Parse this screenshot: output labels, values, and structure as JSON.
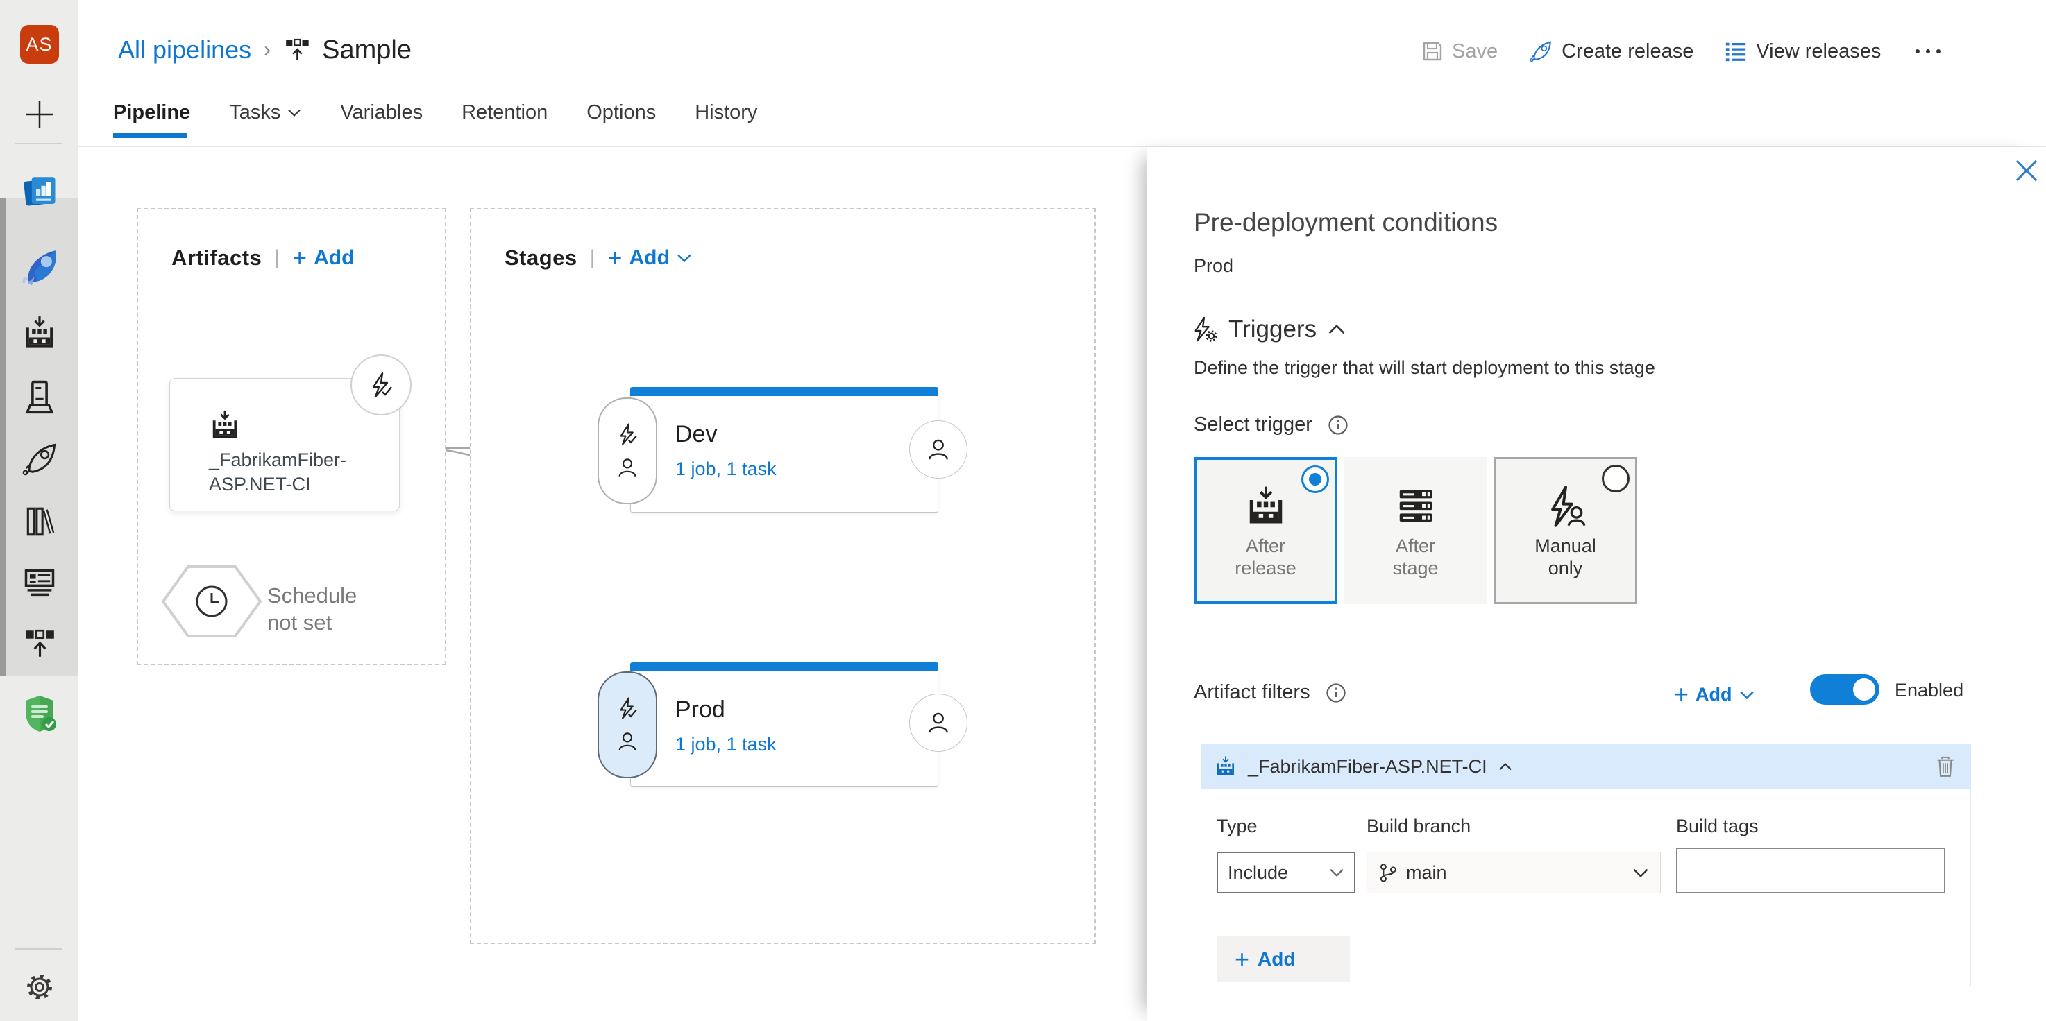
{
  "colors": {
    "accent": "#0e77d1",
    "stage_bar": "#0f7fd7",
    "sidebar_bg": "#ececeb",
    "hub_bg": "#dcdcda",
    "filter_header_bg": "#d9eafc",
    "selected_pill_bg": "#dcebf9",
    "avatar_bg": "#c93c0d"
  },
  "sidebar": {
    "avatar_text": "AS"
  },
  "header": {
    "breadcrumb": {
      "root": "All pipelines",
      "current": "Sample"
    },
    "actions": {
      "save": "Save",
      "create_release": "Create release",
      "view_releases": "View releases"
    }
  },
  "tabs": [
    {
      "label": "Pipeline",
      "active": true
    },
    {
      "label": "Tasks",
      "dropdown": true
    },
    {
      "label": "Variables"
    },
    {
      "label": "Retention"
    },
    {
      "label": "Options"
    },
    {
      "label": "History"
    }
  ],
  "canvas": {
    "artifacts": {
      "title": "Artifacts",
      "add_label": "Add",
      "artifact_name": "_FabrikamFiber-ASP.NET-CI",
      "schedule_text": "Schedule not set"
    },
    "stages": {
      "title": "Stages",
      "add_label": "Add",
      "items": [
        {
          "name": "Dev",
          "detail": "1 job, 1 task"
        },
        {
          "name": "Prod",
          "detail": "1 job, 1 task",
          "selected": true
        }
      ]
    }
  },
  "panel": {
    "title": "Pre-deployment conditions",
    "stage": "Prod",
    "triggers": {
      "heading": "Triggers",
      "description": "Define the trigger that will start deployment to this stage"
    },
    "select_trigger_label": "Select trigger",
    "trigger_options": [
      {
        "label": "After release",
        "selected": true
      },
      {
        "label": "After stage"
      },
      {
        "label": "Manual only"
      }
    ],
    "filters": {
      "heading": "Artifact filters",
      "add_label": "Add",
      "toggle_label": "Enabled",
      "filter": {
        "name": "_FabrikamFiber-ASP.NET-CI",
        "type_label": "Type",
        "type_value": "Include",
        "branch_label": "Build branch",
        "branch_value": "main",
        "tags_label": "Build tags",
        "tags_value": "",
        "add_label": "Add"
      }
    }
  }
}
